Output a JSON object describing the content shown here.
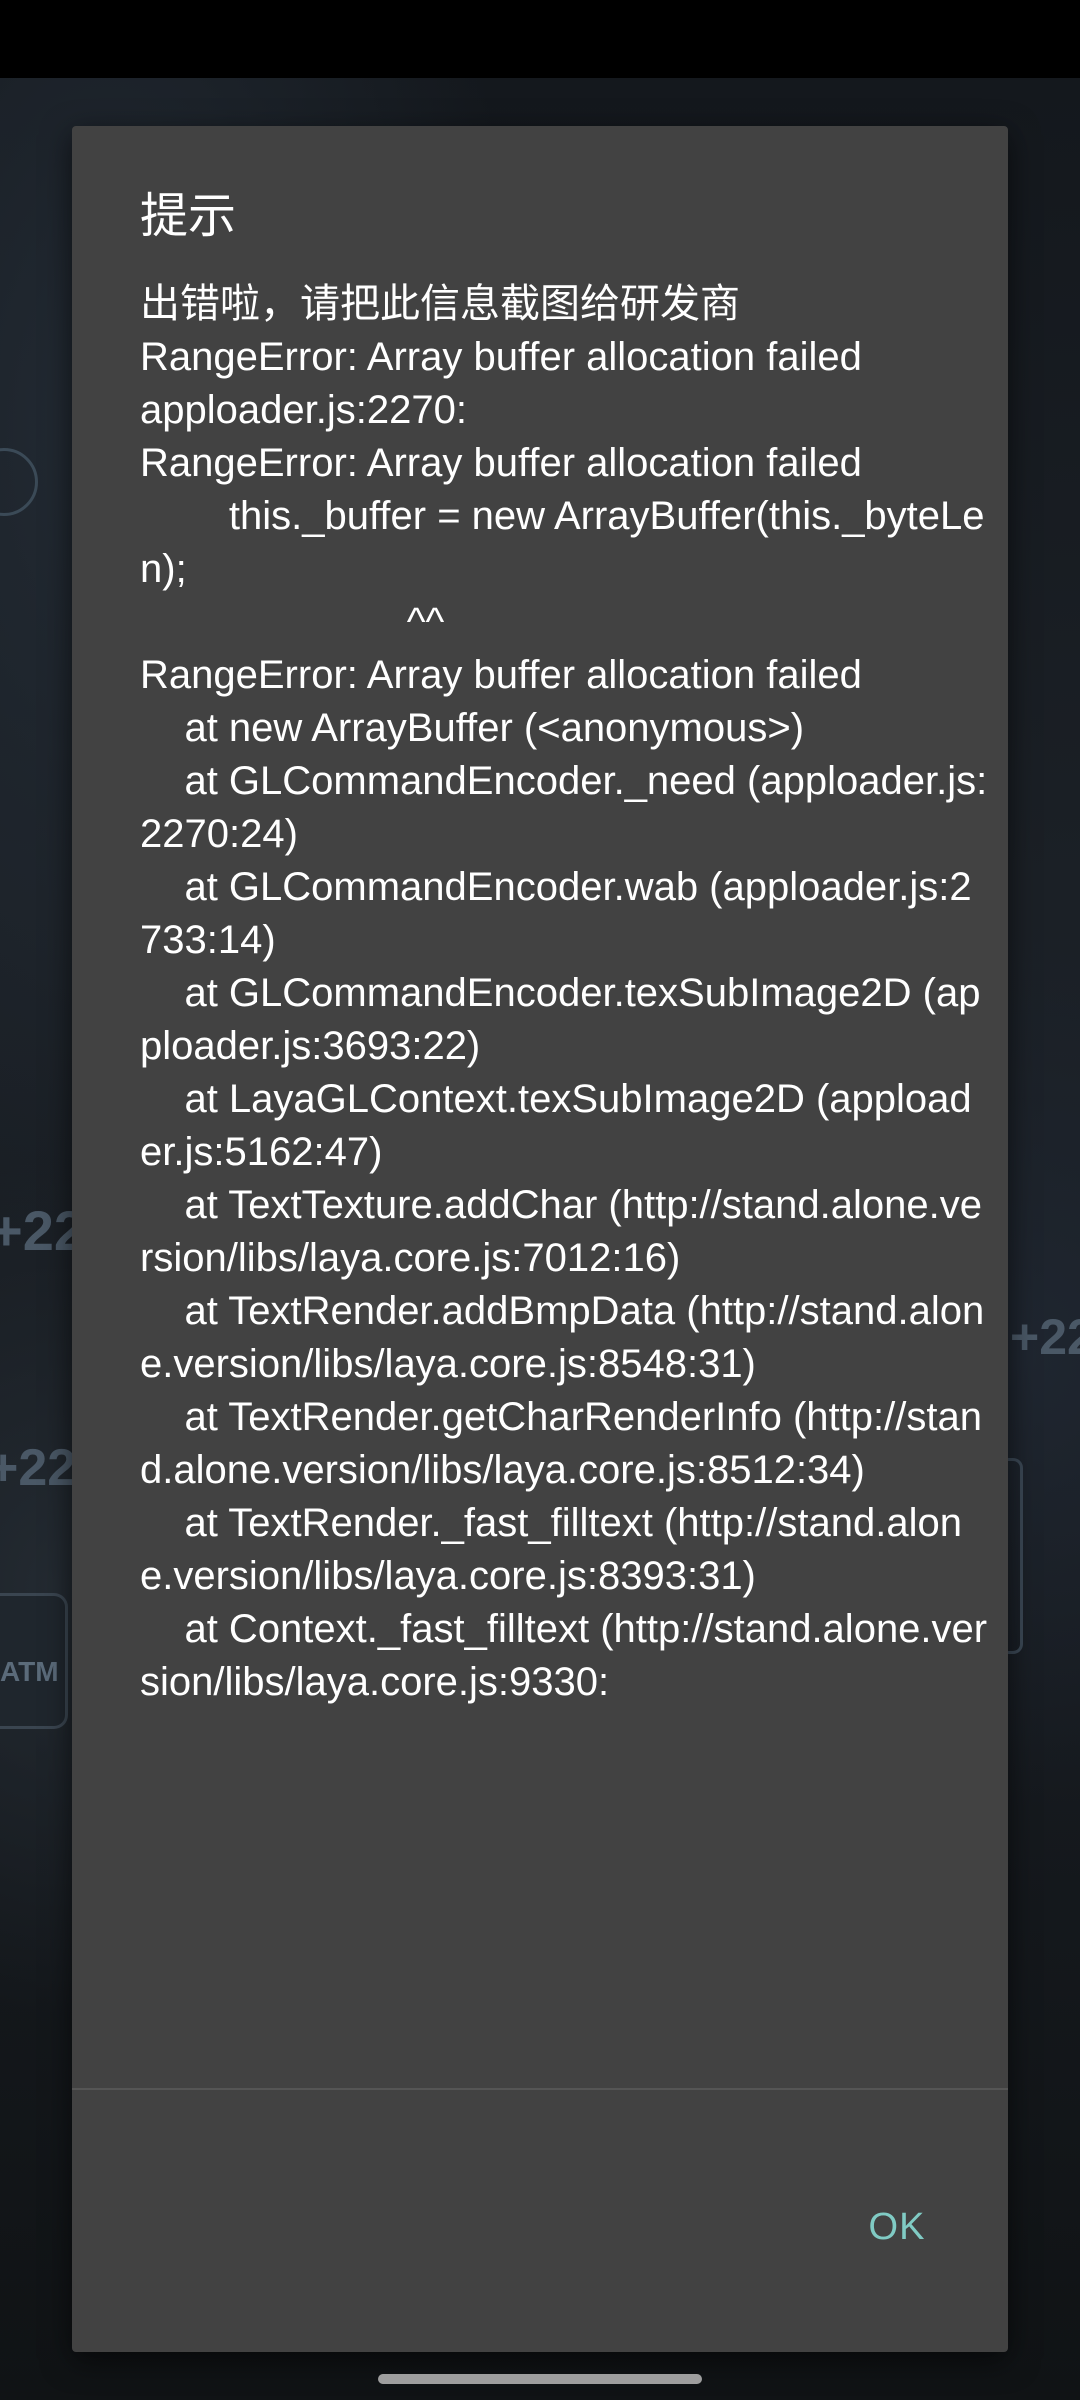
{
  "dialog": {
    "title": "提示",
    "message": "出错啦，请把此信息截图给研发商\nRangeError: Array buffer allocation failed\napploader.js:2270:\nRangeError: Array buffer allocation failed\n        this._buffer = new ArrayBuffer(this._byteLen);\n                        ^^\nRangeError: Array buffer allocation failed\n    at new ArrayBuffer (<anonymous>)\n    at GLCommandEncoder._need (apploader.js:2270:24)\n    at GLCommandEncoder.wab (apploader.js:2733:14)\n    at GLCommandEncoder.texSubImage2D (apploader.js:3693:22)\n    at LayaGLContext.texSubImage2D (apploader.js:5162:47)\n    at TextTexture.addChar (http://stand.alone.version/libs/laya.core.js:7012:16)\n    at TextRender.addBmpData (http://stand.alone.version/libs/laya.core.js:8548:31)\n    at TextRender.getCharRenderInfo (http://stand.alone.version/libs/laya.core.js:8512:34)\n    at TextRender._fast_filltext (http://stand.alone.version/libs/laya.core.js:8393:31)\n    at Context._fast_filltext (http://stand.alone.version/libs/laya.core.js:9330:",
    "ok_label": "OK"
  },
  "background": {
    "bg_number_1": "+22",
    "bg_number_2": "+22",
    "bg_number_3": "+22",
    "bg_atm_label": "ATM"
  },
  "colors": {
    "dialog_bg": "#424242",
    "dialog_text": "#ffffff",
    "ok_accent": "#80cbc4",
    "scrim": "#000000"
  }
}
